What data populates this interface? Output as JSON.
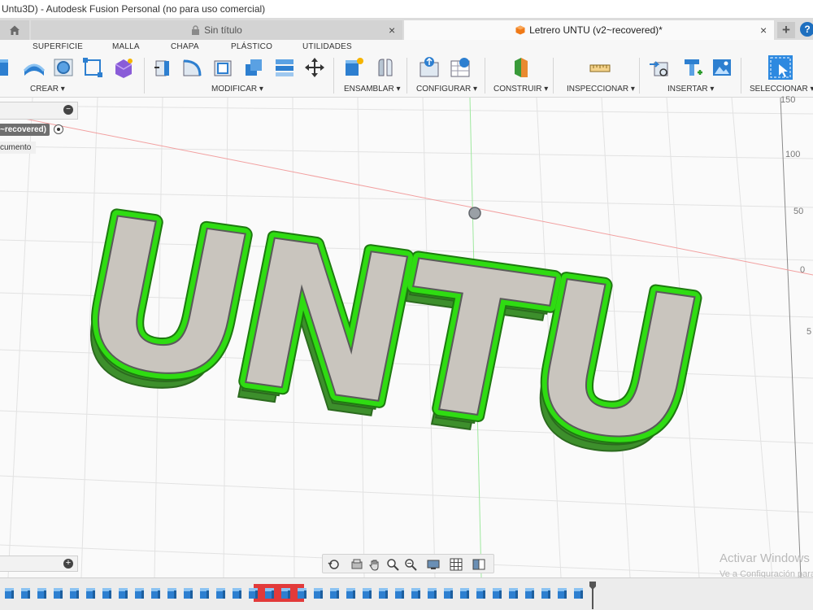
{
  "app": {
    "title": "Untu3D) - Autodesk Fusion Personal (no para uso comercial)"
  },
  "tabs": {
    "untitled_label": "Sin título",
    "active_label": "Letrero UNTU (v2~recovered)*",
    "close_glyph": "×",
    "add_glyph": "+",
    "help_glyph": "?"
  },
  "workspace_tabs": [
    "SUPERFICIE",
    "MALLA",
    "CHAPA",
    "PLÁSTICO",
    "UTILIDADES"
  ],
  "toolbar_groups": [
    "CREAR",
    "MODIFICAR",
    "ENSAMBLAR",
    "CONFIGURAR",
    "CONSTRUIR",
    "INSPECCIONAR",
    "INSERTAR",
    "SELECCIONAR"
  ],
  "browser": {
    "collapse_glyph": "−",
    "root_label": "~recovered)",
    "item_label": "cumento"
  },
  "comments": {
    "add_glyph": "+"
  },
  "axis_labels": [
    "150",
    "100",
    "50",
    "0",
    "5"
  ],
  "model_text": "UNTU",
  "watermark": {
    "line1": "Activar Windows",
    "line2": "Ve a Configuración para"
  },
  "colors": {
    "model_green": "#2fdc12",
    "model_side": "#3d8f2c",
    "model_face": "#c9c5be",
    "accent_blue": "#1e6fbf",
    "timeline_highlight": "#e23a3a"
  },
  "icons": {
    "home": "home-icon",
    "lock": "lock-icon",
    "document": "document-icon",
    "orbit": "orbit-icon",
    "pan": "pan-icon",
    "zoom": "zoom-icon",
    "display": "display-settings-icon",
    "grid": "grid-icon",
    "viewports": "viewports-icon"
  }
}
